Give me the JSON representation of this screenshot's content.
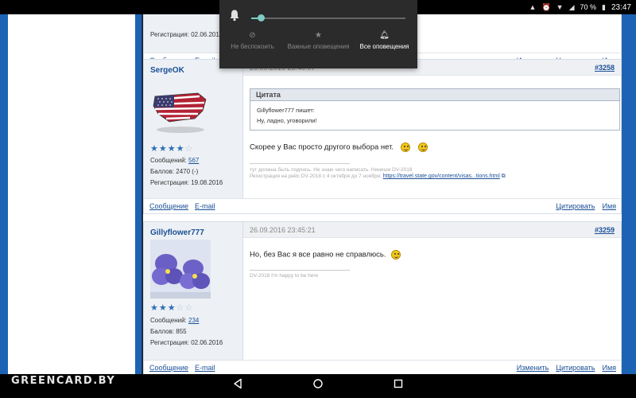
{
  "status_bar": {
    "battery": "70 %",
    "time": "23:47",
    "icons": [
      "alarm-icon",
      "wifi-icon",
      "signal-icon",
      "battery-icon",
      "notification-icon"
    ]
  },
  "shade": {
    "modes": [
      {
        "label": "Не беспокоить",
        "icon": "dnd-icon"
      },
      {
        "label": "Важные оповещения",
        "icon": "star-icon"
      },
      {
        "label": "Все оповещения",
        "icon": "bell-icon"
      }
    ],
    "selected_mode": 2,
    "volume_level": 0.06
  },
  "post_top": {
    "registration": "Регистрация: 02.06.201",
    "footer": {
      "message": "Сообщение",
      "email": "E-mail",
      "edit": "Изменить",
      "quote": "Цитировать",
      "name": "Имя"
    }
  },
  "post1": {
    "author": "SergeOK",
    "date": "26.09.2016 23:40:07",
    "num": "#3258",
    "stars": [
      1,
      1,
      1,
      1,
      0
    ],
    "messages_label": "Сообщений:",
    "messages": "567",
    "points": "Баллов: 2470 (-)",
    "registration": "Регистрация: 19.08.2016",
    "quote_title": "Цитата",
    "quote_author": "Gillyflower777 пишет:",
    "quote_text": "Ну, ладно, уговорили!",
    "text": "Скорее у Вас просто другого выбора нет.",
    "sig1": "тут должна быть подпись. Не знаю чего написать. Ниииши DV-2018",
    "sig2": "Регистрация на рейс DV-2018 с 4 октября до 7 ноября:",
    "sig_link": "https://travel.state.gov/content/visas...tions.html",
    "footer": {
      "message": "Сообщение",
      "email": "E-mail",
      "quote": "Цитировать",
      "name": "Имя"
    }
  },
  "post2": {
    "author": "Gillyflower777",
    "date": "26.09.2016 23:45:21",
    "num": "#3259",
    "stars": [
      1,
      1,
      1,
      0,
      0
    ],
    "messages_label": "Сообщений:",
    "messages": "234",
    "points": "Баллов: 855",
    "registration": "Регистрация: 02.06.2016",
    "text": "Но, без Вас я все равно не справлюсь.",
    "sig": "DV-2018 I'm happy to be here",
    "footer": {
      "message": "Сообщение",
      "email": "E-mail",
      "edit": "Изменить",
      "quote": "Цитировать",
      "name": "Имя"
    }
  },
  "watermark": "GREENCARD.BY",
  "nav_icons": [
    "back-icon",
    "home-icon",
    "recents-icon"
  ]
}
